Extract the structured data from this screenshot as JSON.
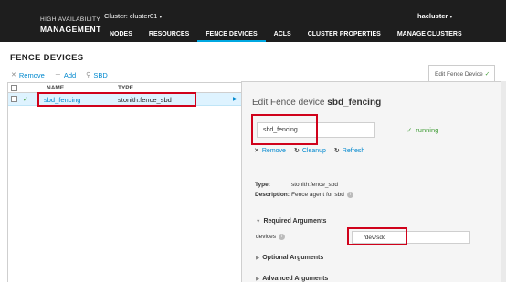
{
  "header": {
    "brand_small": "HIGH AVAILABILITY",
    "brand_big": "MANAGEMENT",
    "cluster_select": "Cluster: cluster01",
    "user": "hacluster",
    "nav": [
      "NODES",
      "RESOURCES",
      "FENCE DEVICES",
      "ACLS",
      "CLUSTER PROPERTIES",
      "MANAGE CLUSTERS"
    ],
    "active_nav": "FENCE DEVICES"
  },
  "page": {
    "title": "FENCE DEVICES",
    "toolbar": {
      "remove": "Remove",
      "add": "Add",
      "sbd": "SBD"
    },
    "right_tab": "Edit Fence Device"
  },
  "list": {
    "columns": [
      "NAME",
      "TYPE"
    ],
    "rows": [
      {
        "name": "sbd_fencing",
        "type": "stonith:fence_sbd",
        "status": "ok",
        "selected": true
      }
    ]
  },
  "detail": {
    "title_prefix": "Edit Fence device",
    "title_name": "sbd_fencing",
    "name_value": "sbd_fencing",
    "status": "running",
    "actions": {
      "remove": "Remove",
      "cleanup": "Cleanup",
      "refresh": "Refresh"
    },
    "type_label": "Type:",
    "type_value": "stonith:fence_sbd",
    "description_label": "Description:",
    "description_value": "Fence agent for sbd",
    "required_args": "Required Arguments",
    "devices_label": "devices",
    "devices_value": "/dev/sdc",
    "optional_args": "Optional Arguments",
    "advanced_args": "Advanced Arguments"
  },
  "colors": {
    "topbar": "#1e1e1e",
    "link": "#0088ce",
    "success": "#3f9c35",
    "highlight_box": "#d0021b",
    "selected_row": "#def3ff"
  },
  "icons": {
    "remove": "close-icon",
    "add": "plus-icon",
    "sbd": "wrench-icon",
    "status": "check-icon",
    "cleanup": "refresh-icon",
    "refresh": "refresh-icon",
    "info": "info-icon",
    "expand": "triangle-icon"
  }
}
